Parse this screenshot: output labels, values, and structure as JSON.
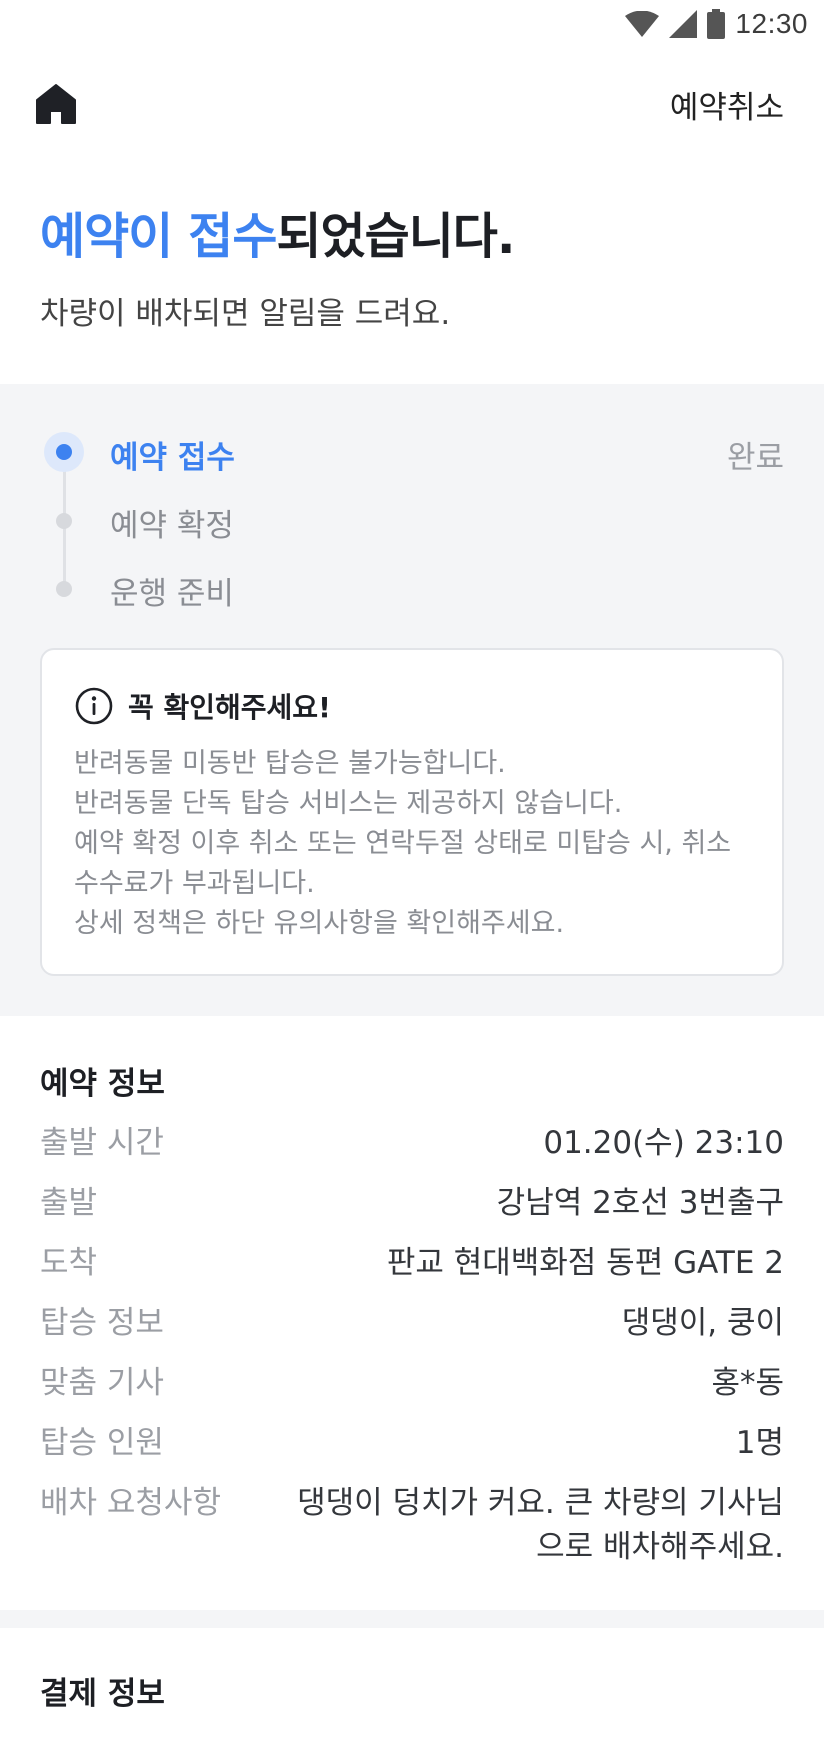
{
  "status_bar": {
    "time": "12:30",
    "icons": [
      "wifi-icon",
      "signal-icon",
      "battery-icon"
    ]
  },
  "header": {
    "home_icon": "home-icon",
    "cancel_label": "예약취소"
  },
  "hero": {
    "title_accent": "예약이 접수",
    "title_rest": "되었습니다.",
    "subtitle": "차량이 배차되면 알림을 드려요."
  },
  "steps": [
    {
      "label": "예약 접수",
      "status": "완료",
      "active": true
    },
    {
      "label": "예약 확정",
      "status": "",
      "active": false
    },
    {
      "label": "운행 준비",
      "status": "",
      "active": false
    }
  ],
  "notice": {
    "title": "꼭 확인해주세요!",
    "lines": [
      "반려동물 미동반 탑승은 불가능합니다.",
      "반려동물 단독 탑승 서비스는 제공하지 않습니다.",
      "예약 확정 이후 취소 또는 연락두절 상태로 미탑승 시, 취소 수수료가 부과됩니다.",
      "상세 정책은 하단 유의사항을 확인해주세요."
    ]
  },
  "reservation": {
    "title": "예약 정보",
    "rows": [
      {
        "key": "출발 시간",
        "value": "01.20(수) 23:10"
      },
      {
        "key": "출발",
        "value": "강남역 2호선 3번출구"
      },
      {
        "key": "도착",
        "value": "판교 현대백화점 동편 GATE 2"
      },
      {
        "key": "탑승 정보",
        "value": "댕댕이, 쿵이"
      },
      {
        "key": "맞춤 기사",
        "value": "홍*동"
      },
      {
        "key": "탑승 인원",
        "value": "1명"
      },
      {
        "key": "배차 요청사항",
        "value": "댕댕이 덩치가 커요. 큰 차량의 기사님으로 배차해주세요."
      }
    ]
  },
  "payment": {
    "title": "결제 정보"
  },
  "colors": {
    "accent": "#3d82f0",
    "band": "#f4f5f7"
  }
}
